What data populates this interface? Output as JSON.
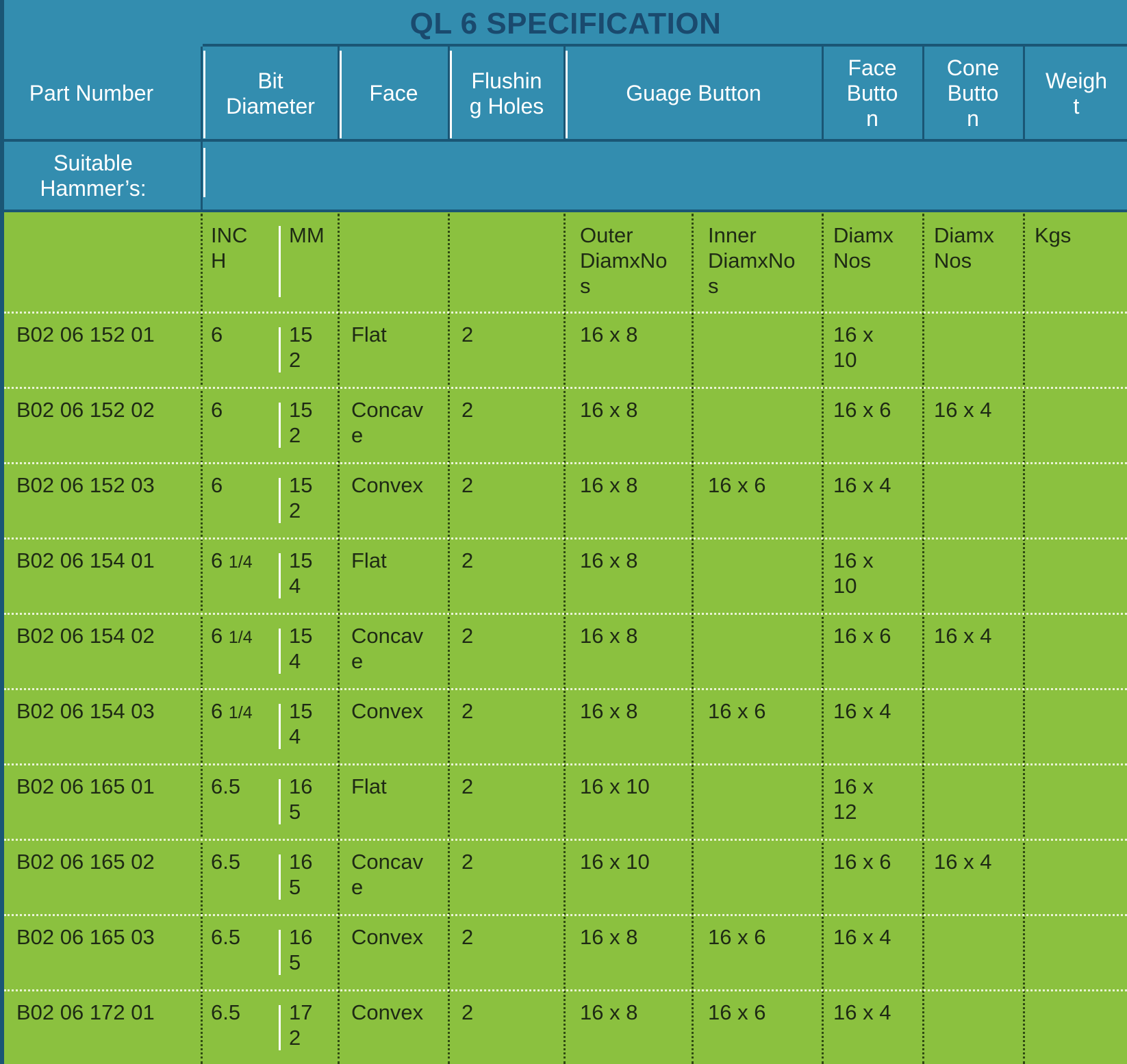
{
  "title": "QL 6 SPECIFICATION",
  "header": {
    "part_number": "Part Number",
    "bit_diameter": "Bit\nDiameter",
    "face": "Face",
    "flushing_holes": "Flushin\ng Holes",
    "guage_button": "Guage Button",
    "face_button": "Face\nButto\nn",
    "cone_button": "Cone\nButto\nn",
    "weight": "Weigh\nt",
    "suitable_hammers": "Suitable\nHammer’s:"
  },
  "subheader": {
    "inch": "INC\nH",
    "mm": "MM",
    "outer": "Outer\nDiamxNo\ns",
    "inner": "Inner\nDiamxNo\ns",
    "face_diam": "Diamx\nNos",
    "cone_diam": "Diamx\nNos",
    "kgs": "Kgs"
  },
  "rows": [
    {
      "part": "B02 06 152 01",
      "inch": "6",
      "inch_frac": "",
      "mm": "15\n2",
      "face": "Flat",
      "holes": "2",
      "outer": "16 x 8",
      "inner": "",
      "face_btn": "16 x\n10",
      "cone_btn": "",
      "weight": ""
    },
    {
      "part": "B02 06 152 02",
      "inch": "6",
      "inch_frac": "",
      "mm": "15\n2",
      "face": "Concav\ne",
      "holes": "2",
      "outer": "16 x 8",
      "inner": "",
      "face_btn": "16 x 6",
      "cone_btn": "16 x 4",
      "weight": ""
    },
    {
      "part": "B02 06 152 03",
      "inch": "6",
      "inch_frac": "",
      "mm": "15\n2",
      "face": "Convex",
      "holes": "2",
      "outer": "16 x 8",
      "inner": "16 x 6",
      "face_btn": "16 x 4",
      "cone_btn": "",
      "weight": ""
    },
    {
      "part": "B02 06 154 01",
      "inch": "6 ",
      "inch_frac": "1/4",
      "mm": "15\n4",
      "face": "Flat",
      "holes": "2",
      "outer": "16 x 8",
      "inner": "",
      "face_btn": "16 x\n10",
      "cone_btn": "",
      "weight": ""
    },
    {
      "part": "B02 06 154 02",
      "inch": "6 ",
      "inch_frac": "1/4",
      "mm": "15\n4",
      "face": "Concav\ne",
      "holes": "2",
      "outer": "16 x 8",
      "inner": "",
      "face_btn": "16 x 6",
      "cone_btn": "16 x 4",
      "weight": ""
    },
    {
      "part": "B02 06 154 03",
      "inch": "6 ",
      "inch_frac": "1/4",
      "mm": "15\n4",
      "face": "Convex",
      "holes": "2",
      "outer": "16 x 8",
      "inner": "16 x 6",
      "face_btn": "16 x 4",
      "cone_btn": "",
      "weight": ""
    },
    {
      "part": "B02 06 165 01",
      "inch": "6.5",
      "inch_frac": "",
      "mm": "16\n5",
      "face": "Flat",
      "holes": "2",
      "outer": "16 x 10",
      "inner": "",
      "face_btn": "16 x\n12",
      "cone_btn": "",
      "weight": ""
    },
    {
      "part": "B02 06 165 02",
      "inch": "6.5",
      "inch_frac": "",
      "mm": "16\n5",
      "face": "Concav\ne",
      "holes": "2",
      "outer": "16 x 10",
      "inner": "",
      "face_btn": "16 x 6",
      "cone_btn": "16 x 4",
      "weight": ""
    },
    {
      "part": "B02 06 165 03",
      "inch": "6.5",
      "inch_frac": "",
      "mm": "16\n5",
      "face": "Convex",
      "holes": "2",
      "outer": "16 x 8",
      "inner": "16 x 6",
      "face_btn": "16 x 4",
      "cone_btn": "",
      "weight": ""
    },
    {
      "part": "B02 06 172 01",
      "inch": "6.5",
      "inch_frac": "",
      "mm": "17\n2",
      "face": "Convex",
      "holes": "2",
      "outer": "16 x 8",
      "inner": "16 x 6",
      "face_btn": "16 x 4",
      "cone_btn": "",
      "weight": ""
    }
  ]
}
